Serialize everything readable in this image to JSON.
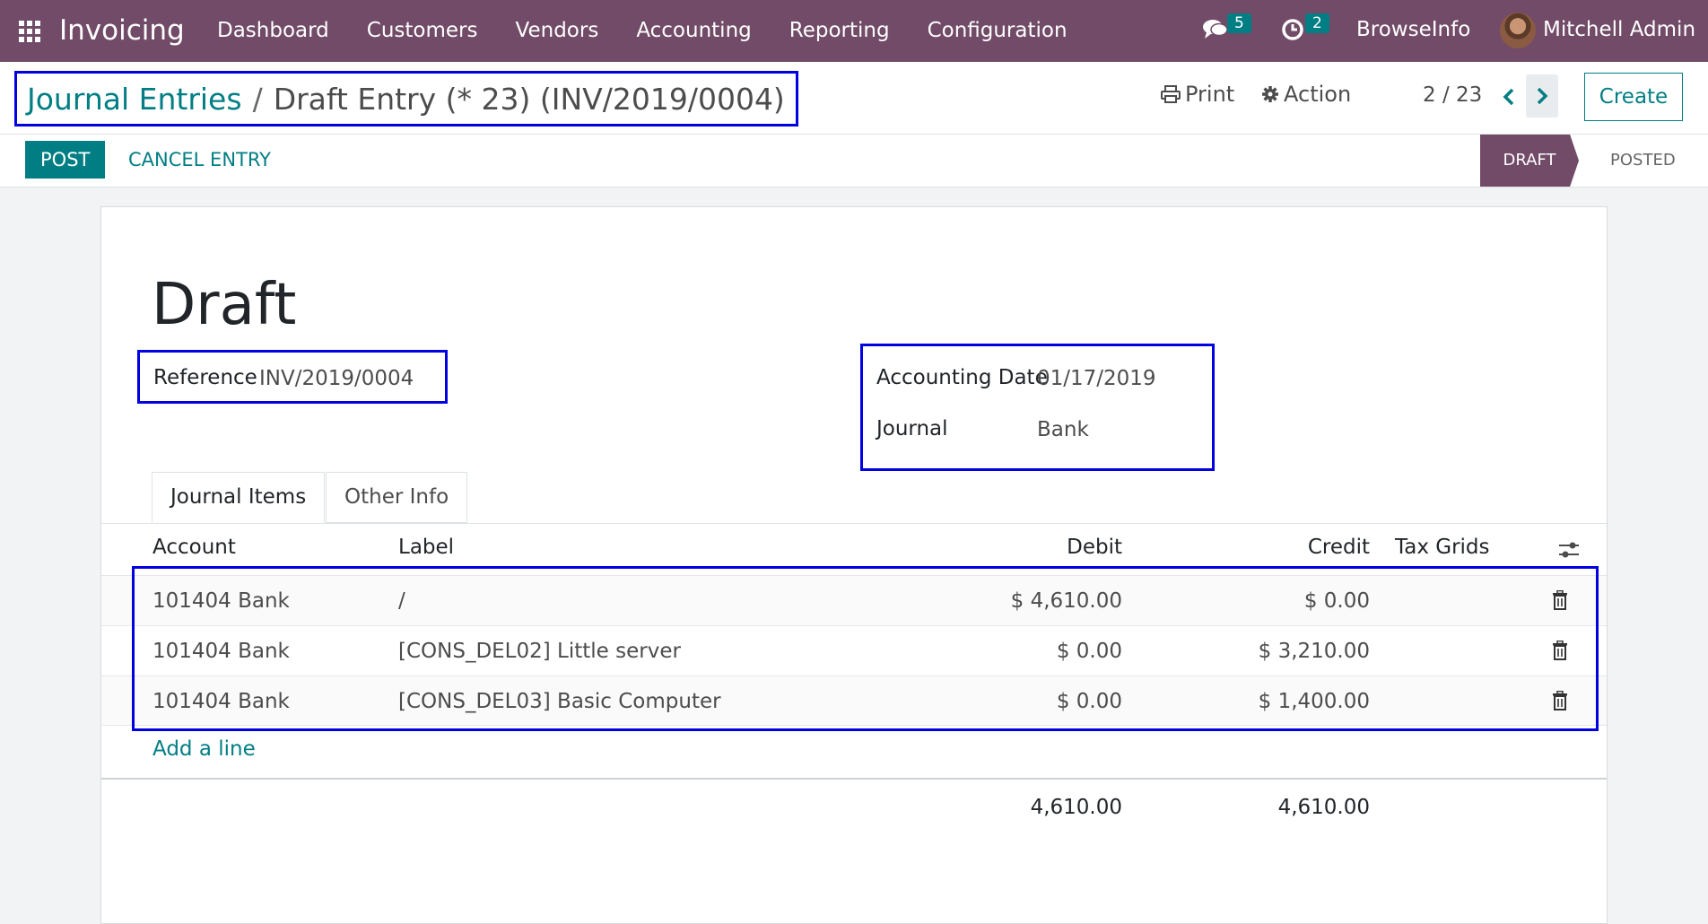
{
  "nav": {
    "app_name": "Invoicing",
    "menu": [
      "Dashboard",
      "Customers",
      "Vendors",
      "Accounting",
      "Reporting",
      "Configuration"
    ],
    "messages_count": "5",
    "activities_count": "2",
    "company": "BrowseInfo",
    "user": "Mitchell Admin"
  },
  "breadcrumb": {
    "parent": "Journal Entries",
    "separator": "/",
    "current": "Draft Entry (* 23) (INV/2019/0004)"
  },
  "control": {
    "print_label": "Print",
    "action_label": "Action",
    "pager_value": "2 / 23",
    "create_label": "Create"
  },
  "statusbar": {
    "post_label": "POST",
    "cancel_label": "CANCEL ENTRY",
    "stages": [
      "DRAFT",
      "POSTED"
    ],
    "active_stage": "DRAFT"
  },
  "form": {
    "state_title": "Draft",
    "reference_label": "Reference",
    "reference_value": "INV/2019/0004",
    "accounting_date_label": "Accounting Date",
    "accounting_date_value": "01/17/2019",
    "journal_label": "Journal",
    "journal_value": "Bank"
  },
  "tabs": [
    "Journal Items",
    "Other Info"
  ],
  "table": {
    "columns": [
      "Account",
      "Label",
      "Debit",
      "Credit",
      "Tax Grids"
    ],
    "rows": [
      {
        "account": "101404 Bank",
        "label": "/",
        "debit": "$ 4,610.00",
        "credit": "$ 0.00",
        "tax_grids": ""
      },
      {
        "account": "101404 Bank",
        "label": "[CONS_DEL02] Little server",
        "debit": "$ 0.00",
        "credit": "$ 3,210.00",
        "tax_grids": ""
      },
      {
        "account": "101404 Bank",
        "label": "[CONS_DEL03] Basic Computer",
        "debit": "$ 0.00",
        "credit": "$ 1,400.00",
        "tax_grids": ""
      }
    ],
    "add_line_label": "Add a line",
    "total_debit": "4,610.00",
    "total_credit": "4,610.00"
  },
  "colors": {
    "brand": "#714b67",
    "accent": "#017e84",
    "highlight": "#0000e0"
  },
  "icons": [
    "apps-grid-icon",
    "chat-icon",
    "clock-icon",
    "print-icon",
    "gear-icon",
    "chevron-left-icon",
    "chevron-right-icon",
    "column-settings-icon",
    "trash-icon"
  ]
}
